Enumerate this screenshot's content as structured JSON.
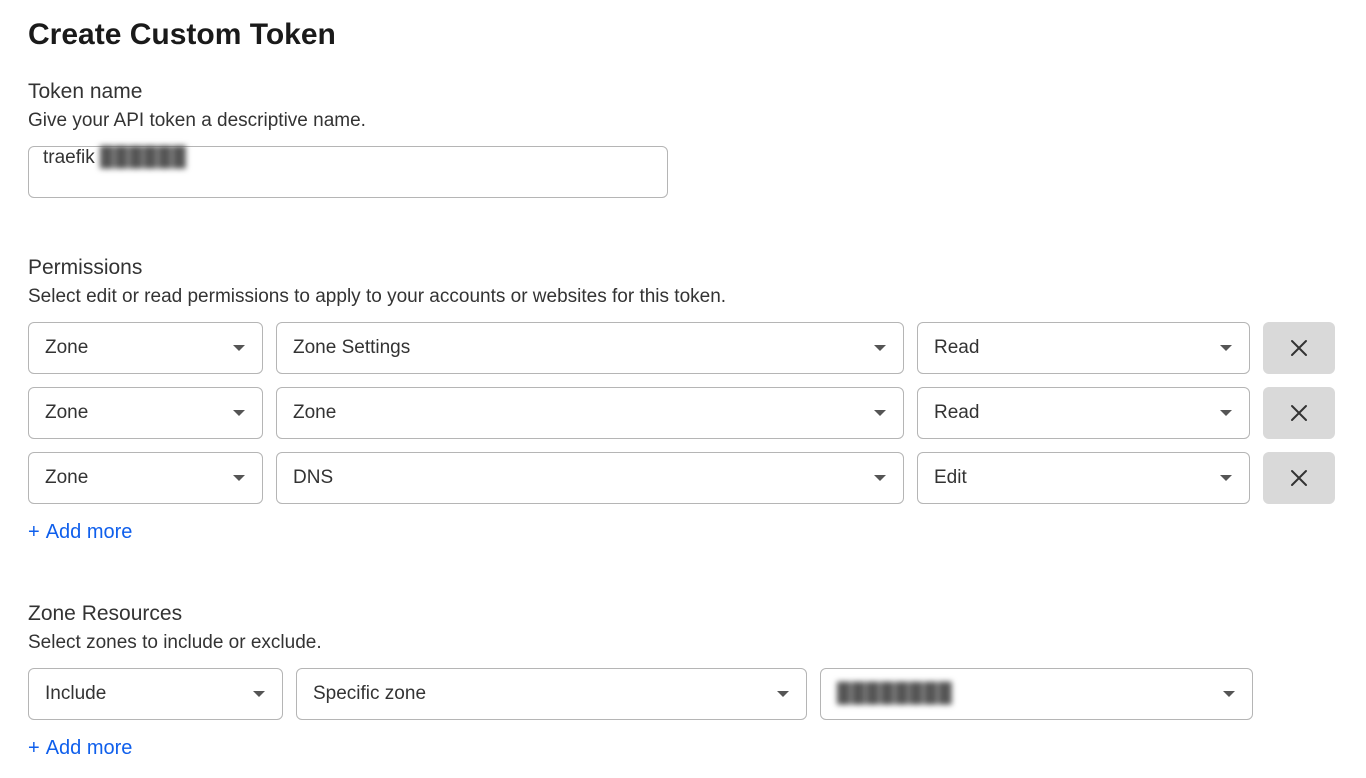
{
  "page": {
    "title": "Create Custom Token"
  },
  "tokenName": {
    "label": "Token name",
    "desc": "Give your API token a descriptive name.",
    "value": "traefik ",
    "blurred_suffix": "██████"
  },
  "permissions": {
    "label": "Permissions",
    "desc": "Select edit or read permissions to apply to your accounts or websites for this token.",
    "rows": [
      {
        "scope": "Zone",
        "resource": "Zone Settings",
        "access": "Read"
      },
      {
        "scope": "Zone",
        "resource": "Zone",
        "access": "Read"
      },
      {
        "scope": "Zone",
        "resource": "DNS",
        "access": "Edit"
      }
    ],
    "add_more": "Add more"
  },
  "zoneResources": {
    "label": "Zone Resources",
    "desc": "Select zones to include or exclude.",
    "rows": [
      {
        "mode": "Include",
        "scope": "Specific zone",
        "zone_blurred": "████████"
      }
    ],
    "add_more": "Add more"
  }
}
